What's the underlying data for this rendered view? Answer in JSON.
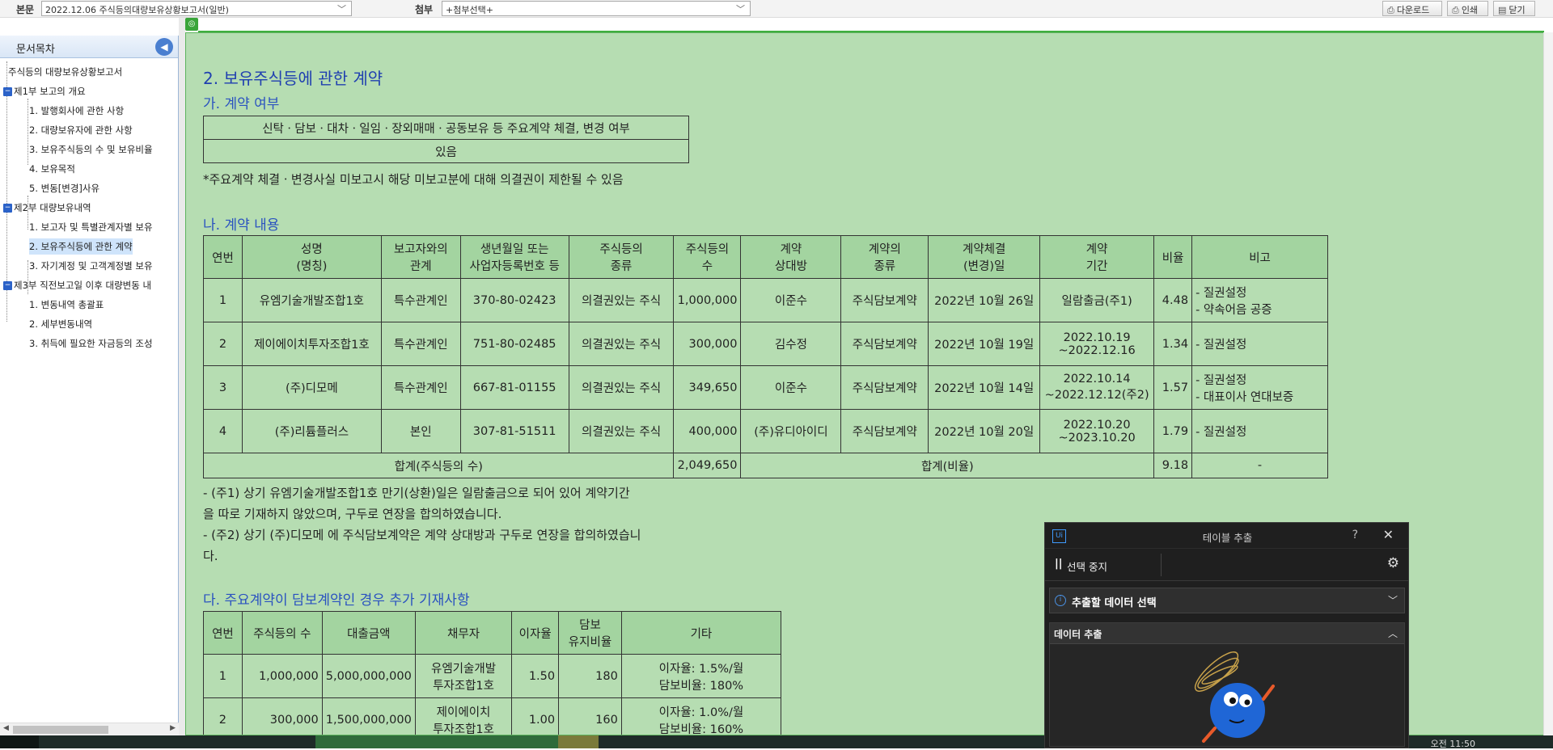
{
  "topbar": {
    "main_label": "본문",
    "main_value": "2022.12.06  주식등의대량보유상황보고서(일반)",
    "attach_label": "첨부",
    "attach_value": "+첨부선택+",
    "download": "다운로드",
    "print": "인쇄",
    "close": "닫기"
  },
  "sidebar": {
    "title": "문서목차",
    "items": [
      {
        "label": "주식등의 대량보유상황보고서"
      },
      {
        "label": "제1부 보고의 개요"
      },
      {
        "label": "1. 발행회사에 관한 사항"
      },
      {
        "label": "2. 대량보유자에 관한 사항"
      },
      {
        "label": "3. 보유주식등의 수 및 보유비율"
      },
      {
        "label": "4. 보유목적"
      },
      {
        "label": "5. 변동[변경]사유"
      },
      {
        "label": "제2부 대량보유내역"
      },
      {
        "label": "1. 보고자 및 특별관계자별 보유"
      },
      {
        "label": "2. 보유주식등에 관한 계약"
      },
      {
        "label": "3. 자기계정 및 고객계정별 보유"
      },
      {
        "label": "제3부 직전보고일 이후 대량변동 내"
      },
      {
        "label": "1. 변동내역 총괄표"
      },
      {
        "label": "2. 세부변동내역"
      },
      {
        "label": "3. 취득에 필요한 자금등의 조성"
      }
    ]
  },
  "doc": {
    "section_title": "2. 보유주식등에 관한 계약",
    "sub_a": "가. 계약 여부",
    "table_a": {
      "header": "신탁ㆍ담보ㆍ대차ㆍ일임ㆍ장외매매ㆍ공동보유 등 주요계약 체결, 변경 여부",
      "value": "있음"
    },
    "note_a": "*주요계약 체결ㆍ변경사실 미보고시 해당 미보고분에 대해 의결권이 제한될 수 있음",
    "sub_b": "나. 계약 내용",
    "table_b": {
      "headers": [
        [
          "연번"
        ],
        [
          "성명",
          "(명칭)"
        ],
        [
          "보고자와의",
          "관계"
        ],
        [
          "생년월일 또는",
          "사업자등록번호 등"
        ],
        [
          "주식등의",
          "종류"
        ],
        [
          "주식등의",
          "수"
        ],
        [
          "계약",
          "상대방"
        ],
        [
          "계약의",
          "종류"
        ],
        [
          "계약체결",
          "(변경)일"
        ],
        [
          "계약",
          "기간"
        ],
        [
          "비율"
        ],
        [
          "비고"
        ]
      ],
      "rows": [
        {
          "no": "1",
          "name": "유엠기술개발조합1호",
          "rel": "특수관계인",
          "id": "370-80-02423",
          "kind": "의결권있는 주식",
          "qty": "1,000,000",
          "party": "이준수",
          "ctype": "주식담보계약",
          "date": "2022년 10월 26일",
          "period1": "일람출금(주1)",
          "period2": "",
          "ratio": "4.48",
          "note1": "- 질권설정",
          "note2": "- 약속어음 공증"
        },
        {
          "no": "2",
          "name": "제이에이치투자조합1호",
          "rel": "특수관계인",
          "id": "751-80-02485",
          "kind": "의결권있는 주식",
          "qty": "300,000",
          "party": "김수정",
          "ctype": "주식담보계약",
          "date": "2022년 10월 19일",
          "period1": "2022.10.19",
          "period2": "~2022.12.16",
          "ratio": "1.34",
          "note1": "- 질권설정",
          "note2": ""
        },
        {
          "no": "3",
          "name": "(주)디모메",
          "rel": "특수관계인",
          "id": "667-81-01155",
          "kind": "의결권있는 주식",
          "qty": "349,650",
          "party": "이준수",
          "ctype": "주식담보계약",
          "date": "2022년 10월 14일",
          "period1": "2022.10.14",
          "period2": "~2022.12.12(주2)",
          "ratio": "1.57",
          "note1": "- 질권설정",
          "note2": "- 대표이사 연대보증"
        },
        {
          "no": "4",
          "name": "(주)리튬플러스",
          "rel": "본인",
          "id": "307-81-51511",
          "kind": "의결권있는 주식",
          "qty": "400,000",
          "party": "(주)유디아이디",
          "ctype": "주식담보계약",
          "date": "2022년 10월 20일",
          "period1": "2022.10.20",
          "period2": "~2023.10.20",
          "ratio": "1.79",
          "note1": "- 질권설정",
          "note2": ""
        }
      ],
      "total_label": "합계(주식등의 수)",
      "total_qty": "2,049,650",
      "total_ratio_label": "합계(비율)",
      "total_ratio": "9.18",
      "total_note": "-"
    },
    "foot1a": "- (주1) 상기 유엠기술개발조합1호 만기(상환)일은 일람출금으로 되어 있어 계약기간",
    "foot1b": "을 따로 기재하지 않았으며, 구두로 연장을 합의하였습니다.",
    "foot2a": "- (주2) 상기 (주)디모메 에 주식담보계약은 계약 상대방과 구두로 연장을 합의하였습니",
    "foot2b": "다.",
    "sub_c": "다. 주요계약이 담보계약인 경우 추가 기재사항",
    "table_c": {
      "headers": [
        [
          "연번"
        ],
        [
          "주식등의 수"
        ],
        [
          "대출금액"
        ],
        [
          "채무자"
        ],
        [
          "이자율"
        ],
        [
          "담보",
          "유지비율"
        ],
        [
          "기타"
        ]
      ],
      "rows": [
        {
          "no": "1",
          "qty": "1,000,000",
          "loan": "5,000,000,000",
          "debtor1": "유엠기술개발",
          "debtor2": "투자조합1호",
          "rate": "1.50",
          "keep": "180",
          "etc1": "이자율: 1.5%/월",
          "etc2": "담보비율: 180%"
        },
        {
          "no": "2",
          "qty": "300,000",
          "loan": "1,500,000,000",
          "debtor1": "제이에이치",
          "debtor2": "투자조합1호",
          "rate": "1.00",
          "keep": "160",
          "etc1": "이자율: 1.0%/월",
          "etc2": "담보비율: 160%"
        }
      ]
    }
  },
  "extract_panel": {
    "logo": "Ui",
    "title": "테이블 추출",
    "help": "?",
    "close": "✕",
    "pause_icon": "||",
    "stop_label": "선택 중지",
    "select_label": "추출할 데이터 선택",
    "section_label": "데이터 추출"
  },
  "taskbar": {
    "clock": "오전 11:50"
  },
  "colors": {
    "content_bg": "#b6ddb2",
    "table_header": "#a3d4a0",
    "heading_blue": "#2040b0",
    "panel_bg": "#1f1f1f"
  }
}
